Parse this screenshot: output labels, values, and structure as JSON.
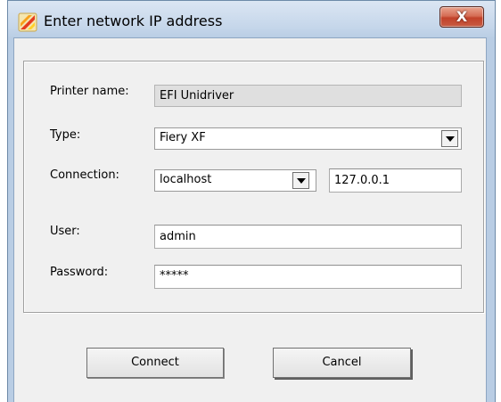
{
  "window": {
    "title": "Enter network IP address",
    "icon": "app-logo-icon",
    "close_glyph": "X"
  },
  "form": {
    "printer_name": {
      "label": "Printer name:",
      "value": "EFI Unidriver"
    },
    "type": {
      "label": "Type:",
      "value": "Fiery XF"
    },
    "connection": {
      "label": "Connection:",
      "host": "localhost",
      "ip": "127.0.0.1"
    },
    "user": {
      "label": "User:",
      "value": "admin"
    },
    "password": {
      "label": "Password:",
      "value": "*****"
    }
  },
  "buttons": {
    "connect": "Connect",
    "cancel": "Cancel"
  },
  "colors": {
    "close_button": "#c2422a",
    "frame": "#b9cde4",
    "client": "#f0f0f0"
  }
}
